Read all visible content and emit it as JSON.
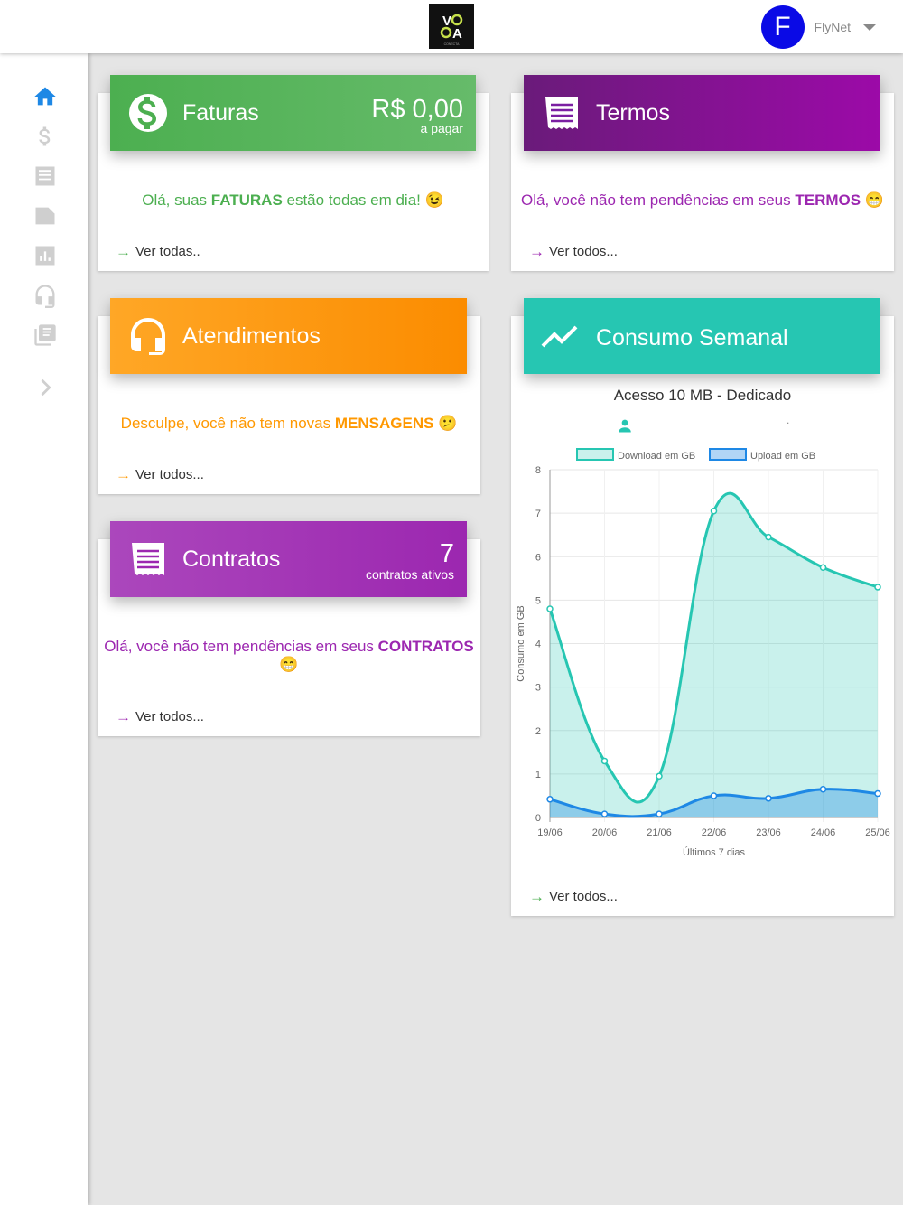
{
  "header": {
    "user_initial": "F",
    "user_name": "FlyNet",
    "logo_letters": "VOOA",
    "logo_sub": "CONECTA"
  },
  "sidebar": {
    "items": [
      {
        "icon": "home-icon",
        "active": true
      },
      {
        "icon": "dollar-icon"
      },
      {
        "icon": "document-icon"
      },
      {
        "icon": "ticket-icon"
      },
      {
        "icon": "bar-chart-icon"
      },
      {
        "icon": "headset-icon"
      },
      {
        "icon": "library-icon"
      },
      {
        "icon": "chevron-right-icon"
      }
    ]
  },
  "colors": {
    "green": "#4caf50",
    "purple_dark": "#7b1fa2",
    "orange": "#ff9800",
    "teal": "#26c6b2",
    "violet": "#9c27b0",
    "blue_active": "#1e88e5"
  },
  "faturas": {
    "title": "Faturas",
    "value": "R$ 0,00",
    "sub": "a pagar",
    "msg_pre": "Olá, suas ",
    "msg_bold": "FATURAS",
    "msg_post": " estão todas em dia! 😉",
    "link": "Ver todas.."
  },
  "termos": {
    "title": "Termos",
    "msg_pre": "Olá, você não tem pendências em seus ",
    "msg_bold": "TERMOS",
    "msg_post": " 😁",
    "link": "Ver todos..."
  },
  "atendimentos": {
    "title": "Atendimentos",
    "msg_pre": "Desculpe, você não tem novas ",
    "msg_bold": "MENSAGENS",
    "msg_post": " 😕",
    "link": "Ver todos..."
  },
  "contratos": {
    "title": "Contratos",
    "value": "7",
    "sub": "contratos ativos",
    "msg_pre": "Olá, você não tem pendências em seus ",
    "msg_bold": "CONTRATOS",
    "msg_post": "😁",
    "link": "Ver todos..."
  },
  "consumo": {
    "title": "Consumo Semanal",
    "plan": "Acesso 10 MB - Dedicado",
    "dot": ".",
    "link": "Ver todos..."
  },
  "chart_data": {
    "type": "area",
    "x": [
      "19/06",
      "20/06",
      "21/06",
      "22/06",
      "23/06",
      "24/06",
      "25/06"
    ],
    "series": [
      {
        "name": "Download em GB",
        "values": [
          4.8,
          1.3,
          0.95,
          7.05,
          6.45,
          5.75,
          5.3
        ],
        "color": "#26c6b2"
      },
      {
        "name": "Upload em GB",
        "values": [
          0.42,
          0.08,
          0.08,
          0.5,
          0.44,
          0.65,
          0.55
        ],
        "color": "#1e88e5"
      }
    ],
    "ylabel": "Consumo em GB",
    "xlabel": "Últimos 7 dias",
    "ylim": [
      0,
      8
    ],
    "yticks": [
      "0",
      "1",
      "2",
      "3",
      "4",
      "5",
      "6",
      "7",
      "8"
    ],
    "grid": true,
    "legend": "top"
  }
}
